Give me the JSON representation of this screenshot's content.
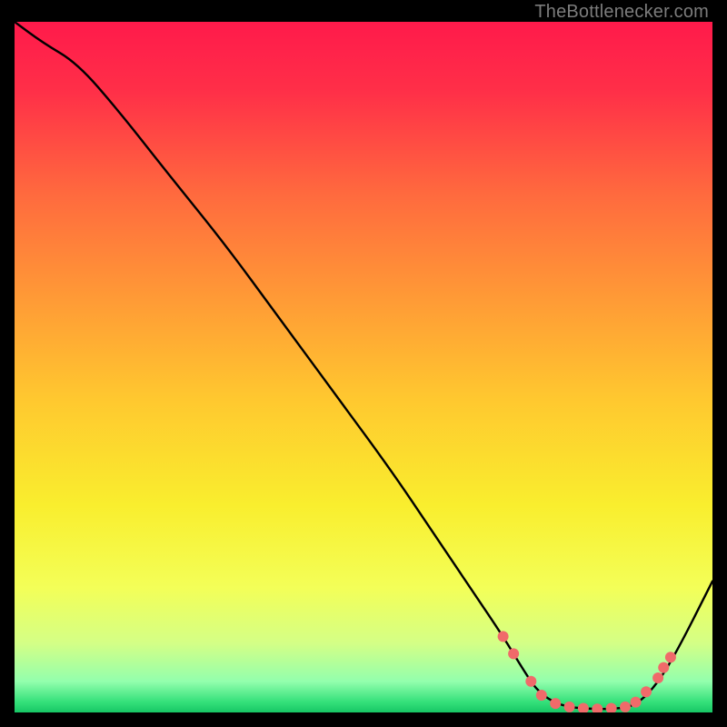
{
  "watermark": "TheBottlenecker.com",
  "chart_data": {
    "type": "line",
    "title": "",
    "xlabel": "",
    "ylabel": "",
    "xlim": [
      0,
      100
    ],
    "ylim": [
      0,
      100
    ],
    "background_gradient": {
      "stops": [
        {
          "pos": 0.0,
          "color": "#ff1a4b"
        },
        {
          "pos": 0.1,
          "color": "#ff2f48"
        },
        {
          "pos": 0.25,
          "color": "#ff6a3e"
        },
        {
          "pos": 0.4,
          "color": "#ff9a36"
        },
        {
          "pos": 0.55,
          "color": "#ffc92f"
        },
        {
          "pos": 0.7,
          "color": "#f9ee2e"
        },
        {
          "pos": 0.82,
          "color": "#f3ff58"
        },
        {
          "pos": 0.9,
          "color": "#d4ff86"
        },
        {
          "pos": 0.955,
          "color": "#93ffad"
        },
        {
          "pos": 0.985,
          "color": "#34e07a"
        },
        {
          "pos": 1.0,
          "color": "#17c765"
        }
      ]
    },
    "series": [
      {
        "name": "bottleneck-curve",
        "x": [
          0,
          4,
          9,
          15,
          22,
          30,
          38,
          46,
          54,
          60,
          66,
          70,
          73,
          75,
          78,
          82,
          86,
          89,
          92,
          95,
          100
        ],
        "y": [
          100,
          97,
          94,
          87,
          78,
          68,
          57,
          46,
          35,
          26,
          17,
          11,
          6,
          3,
          1,
          0.5,
          0.5,
          1,
          4,
          9,
          19
        ]
      }
    ],
    "markers": {
      "name": "highlight-points",
      "color": "#f06a6a",
      "radius": 6,
      "points": [
        {
          "x": 70.0,
          "y": 11.0
        },
        {
          "x": 71.5,
          "y": 8.5
        },
        {
          "x": 74.0,
          "y": 4.5
        },
        {
          "x": 75.5,
          "y": 2.5
        },
        {
          "x": 77.5,
          "y": 1.3
        },
        {
          "x": 79.5,
          "y": 0.8
        },
        {
          "x": 81.5,
          "y": 0.6
        },
        {
          "x": 83.5,
          "y": 0.5
        },
        {
          "x": 85.5,
          "y": 0.6
        },
        {
          "x": 87.5,
          "y": 0.8
        },
        {
          "x": 89.0,
          "y": 1.5
        },
        {
          "x": 90.5,
          "y": 3.0
        },
        {
          "x": 92.2,
          "y": 5.0
        },
        {
          "x": 93.0,
          "y": 6.5
        },
        {
          "x": 94.0,
          "y": 8.0
        }
      ]
    }
  }
}
